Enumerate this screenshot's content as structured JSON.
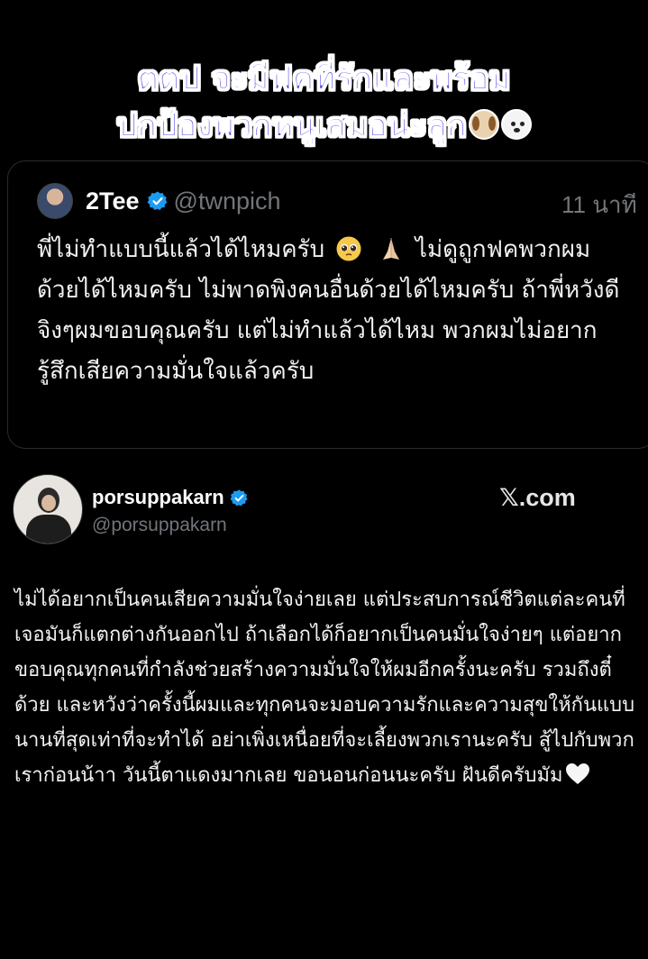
{
  "caption": {
    "line1": "ตตป จะมีฟคที่รักและพร้อม",
    "line2": "ปกป้องพวกหนูเสมอน่ะลูก",
    "emojis": [
      "dog-face",
      "panda-face"
    ]
  },
  "quoted_tweet": {
    "display_name": "2Tee",
    "handle": "@twnpich",
    "time": "11 นาที",
    "text_parts": [
      "พี่ไม่ทำแบบนี้แล้วได้ไหมครับ",
      "ไม่ดูถูกฟคพวกผมด้วยได้ไหมครับ ไม่พาดพิงคนอื่นด้วยได้ไหมครับ ถ้าพี่หวังดีจิงๆผมขอบคุณครับ แต่ไม่ทำแล้วได้ไหม พวกผมไม่อยากรู้สึกเสียความมั่นใจแล้วครับ"
    ],
    "emojis": [
      "pleading-face",
      "folded-hands"
    ]
  },
  "post": {
    "display_name": "porsuppakarn",
    "handle": "@porsuppakarn",
    "source": ".com",
    "source_brand": "𝕏",
    "text": "ไม่ได้อยากเป็นคนเสียความมั่นใจง่ายเลย แต่ประสบการณ์ชีวิตแต่ละคนที่เจอมันก็แตกต่างกันออกไป ถ้าเลือกได้ก็อยากเป็นคนมั่นใจง่ายๆ แต่อยากขอบคุณทุกคนที่กำลังช่วยสร้างความมั่นใจให้ผมอีกครั้งนะครับ รวมถึงตี๋ด้วย และหวังว่าครั้งนี้ผมและทุกคนจะมอบความรักและความสุขให้กันแบบนานที่สุดเท่าที่จะทำได้ อย่าเพิ่งเหนื่อยที่จะเลี้ยงพวกเรานะครับ สู้ไปกับพวกเราก่อนน้าา วันนี้ตาแดงมากเลย ขอนอนก่อนนะครับ ฝันดีครับมัม",
    "end_emoji": "white-heart"
  },
  "colors": {
    "background": "#000000",
    "caption_fill": "#5a55e6",
    "caption_outline": "#ffffff",
    "verified_blue": "#1d9bf0",
    "secondary_text": "#71767b"
  }
}
